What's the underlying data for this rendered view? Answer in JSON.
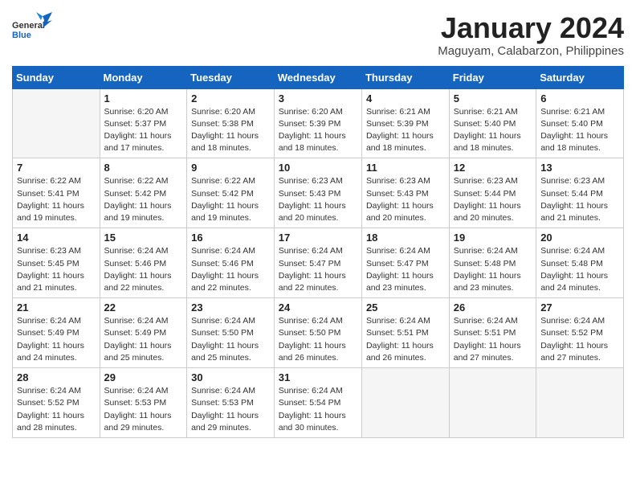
{
  "header": {
    "logo_general": "General",
    "logo_blue": "Blue",
    "month_title": "January 2024",
    "location": "Maguyam, Calabarzon, Philippines"
  },
  "days_of_week": [
    "Sunday",
    "Monday",
    "Tuesday",
    "Wednesday",
    "Thursday",
    "Friday",
    "Saturday"
  ],
  "weeks": [
    [
      {
        "day": "",
        "empty": true
      },
      {
        "day": "1",
        "sunrise": "6:20 AM",
        "sunset": "5:37 PM",
        "daylight": "11 hours and 17 minutes."
      },
      {
        "day": "2",
        "sunrise": "6:20 AM",
        "sunset": "5:38 PM",
        "daylight": "11 hours and 18 minutes."
      },
      {
        "day": "3",
        "sunrise": "6:20 AM",
        "sunset": "5:39 PM",
        "daylight": "11 hours and 18 minutes."
      },
      {
        "day": "4",
        "sunrise": "6:21 AM",
        "sunset": "5:39 PM",
        "daylight": "11 hours and 18 minutes."
      },
      {
        "day": "5",
        "sunrise": "6:21 AM",
        "sunset": "5:40 PM",
        "daylight": "11 hours and 18 minutes."
      },
      {
        "day": "6",
        "sunrise": "6:21 AM",
        "sunset": "5:40 PM",
        "daylight": "11 hours and 18 minutes."
      }
    ],
    [
      {
        "day": "7",
        "sunrise": "6:22 AM",
        "sunset": "5:41 PM",
        "daylight": "11 hours and 19 minutes."
      },
      {
        "day": "8",
        "sunrise": "6:22 AM",
        "sunset": "5:42 PM",
        "daylight": "11 hours and 19 minutes."
      },
      {
        "day": "9",
        "sunrise": "6:22 AM",
        "sunset": "5:42 PM",
        "daylight": "11 hours and 19 minutes."
      },
      {
        "day": "10",
        "sunrise": "6:23 AM",
        "sunset": "5:43 PM",
        "daylight": "11 hours and 20 minutes."
      },
      {
        "day": "11",
        "sunrise": "6:23 AM",
        "sunset": "5:43 PM",
        "daylight": "11 hours and 20 minutes."
      },
      {
        "day": "12",
        "sunrise": "6:23 AM",
        "sunset": "5:44 PM",
        "daylight": "11 hours and 20 minutes."
      },
      {
        "day": "13",
        "sunrise": "6:23 AM",
        "sunset": "5:44 PM",
        "daylight": "11 hours and 21 minutes."
      }
    ],
    [
      {
        "day": "14",
        "sunrise": "6:23 AM",
        "sunset": "5:45 PM",
        "daylight": "11 hours and 21 minutes."
      },
      {
        "day": "15",
        "sunrise": "6:24 AM",
        "sunset": "5:46 PM",
        "daylight": "11 hours and 22 minutes."
      },
      {
        "day": "16",
        "sunrise": "6:24 AM",
        "sunset": "5:46 PM",
        "daylight": "11 hours and 22 minutes."
      },
      {
        "day": "17",
        "sunrise": "6:24 AM",
        "sunset": "5:47 PM",
        "daylight": "11 hours and 22 minutes."
      },
      {
        "day": "18",
        "sunrise": "6:24 AM",
        "sunset": "5:47 PM",
        "daylight": "11 hours and 23 minutes."
      },
      {
        "day": "19",
        "sunrise": "6:24 AM",
        "sunset": "5:48 PM",
        "daylight": "11 hours and 23 minutes."
      },
      {
        "day": "20",
        "sunrise": "6:24 AM",
        "sunset": "5:48 PM",
        "daylight": "11 hours and 24 minutes."
      }
    ],
    [
      {
        "day": "21",
        "sunrise": "6:24 AM",
        "sunset": "5:49 PM",
        "daylight": "11 hours and 24 minutes."
      },
      {
        "day": "22",
        "sunrise": "6:24 AM",
        "sunset": "5:49 PM",
        "daylight": "11 hours and 25 minutes."
      },
      {
        "day": "23",
        "sunrise": "6:24 AM",
        "sunset": "5:50 PM",
        "daylight": "11 hours and 25 minutes."
      },
      {
        "day": "24",
        "sunrise": "6:24 AM",
        "sunset": "5:50 PM",
        "daylight": "11 hours and 26 minutes."
      },
      {
        "day": "25",
        "sunrise": "6:24 AM",
        "sunset": "5:51 PM",
        "daylight": "11 hours and 26 minutes."
      },
      {
        "day": "26",
        "sunrise": "6:24 AM",
        "sunset": "5:51 PM",
        "daylight": "11 hours and 27 minutes."
      },
      {
        "day": "27",
        "sunrise": "6:24 AM",
        "sunset": "5:52 PM",
        "daylight": "11 hours and 27 minutes."
      }
    ],
    [
      {
        "day": "28",
        "sunrise": "6:24 AM",
        "sunset": "5:52 PM",
        "daylight": "11 hours and 28 minutes."
      },
      {
        "day": "29",
        "sunrise": "6:24 AM",
        "sunset": "5:53 PM",
        "daylight": "11 hours and 29 minutes."
      },
      {
        "day": "30",
        "sunrise": "6:24 AM",
        "sunset": "5:53 PM",
        "daylight": "11 hours and 29 minutes."
      },
      {
        "day": "31",
        "sunrise": "6:24 AM",
        "sunset": "5:54 PM",
        "daylight": "11 hours and 30 minutes."
      },
      {
        "day": "",
        "empty": true
      },
      {
        "day": "",
        "empty": true
      },
      {
        "day": "",
        "empty": true
      }
    ]
  ]
}
